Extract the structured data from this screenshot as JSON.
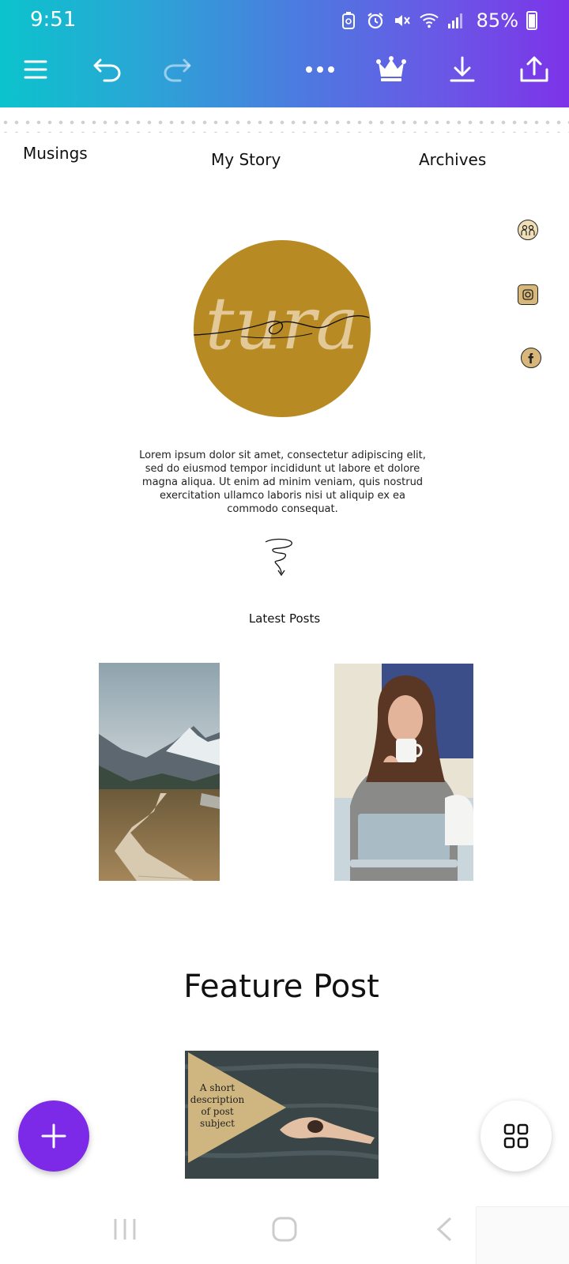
{
  "status_bar": {
    "time": "9:51",
    "battery_percent": "85%",
    "icons": [
      "save-data-icon",
      "alarm-icon",
      "mute-icon",
      "wifi-icon",
      "signal-icon",
      "battery-icon"
    ]
  },
  "toolbar": {
    "icons": [
      "menu-icon",
      "undo-icon",
      "redo-icon",
      "more-icon",
      "crown-icon",
      "download-icon",
      "share-icon"
    ],
    "redo_enabled": false
  },
  "page_nav": {
    "left": "Musings",
    "center": "My Story",
    "right": "Archives"
  },
  "social_icons": [
    "community-icon",
    "instagram-icon",
    "facebook-icon"
  ],
  "logo": {
    "text": "tura",
    "circle_color": "#b88a23"
  },
  "intro_text": "Lorem ipsum dolor sit amet, consectetur adipiscing elit, sed do eiusmod tempor incididunt ut labore et dolore magna aliqua. Ut enim ad minim veniam, quis nostrud exercitation ullamco laboris nisi ut aliquip ex ea commodo consequat.",
  "latest_posts": {
    "heading": "Latest Posts",
    "images": [
      "mountain-boardwalk-photo",
      "woman-coffee-laptop-photo"
    ]
  },
  "feature": {
    "heading": "Feature Post",
    "card_text": "A short description of post subject"
  },
  "fabs": {
    "add_icon": "plus-icon",
    "grid_icon": "grid-icon"
  },
  "system_nav": [
    "recents-icon",
    "home-icon",
    "back-icon"
  ],
  "colors": {
    "brand_purple": "#7d2ae8",
    "gradient_start": "#0bc3cc",
    "gradient_end": "#7d33e8",
    "logo_gold": "#b88a23"
  }
}
